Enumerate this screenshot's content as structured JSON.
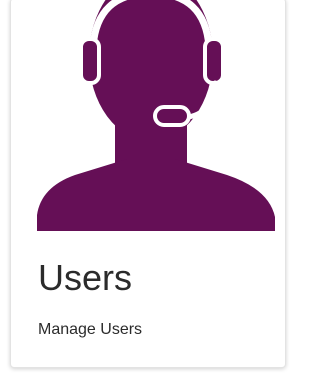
{
  "card": {
    "title": "Users",
    "subtitle": "Manage Users",
    "icon": "support-headset-person-icon",
    "accent_color": "#650f56"
  }
}
